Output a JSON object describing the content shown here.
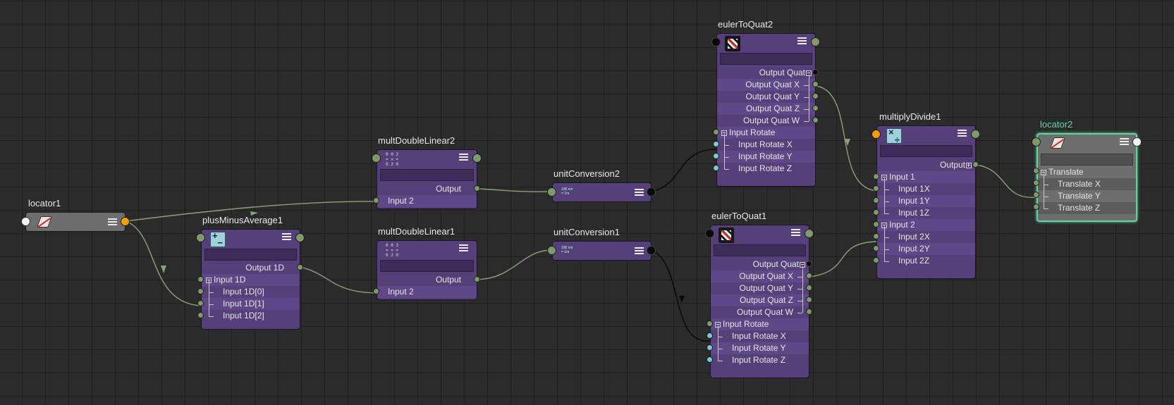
{
  "nodes": {
    "locator1": {
      "title": "locator1"
    },
    "plusMinusAverage1": {
      "title": "plusMinusAverage1",
      "output": "Output 1D",
      "input_group": "Input 1D",
      "inputs": [
        "Input 1D[0]",
        "Input 1D[1]",
        "Input 1D[2]"
      ]
    },
    "multDoubleLinear2": {
      "title": "multDoubleLinear2",
      "output": "Output",
      "input": "Input 2"
    },
    "multDoubleLinear1": {
      "title": "multDoubleLinear1",
      "output": "Output",
      "input": "Input 2"
    },
    "unitConversion2": {
      "title": "unitConversion2"
    },
    "unitConversion1": {
      "title": "unitConversion1"
    },
    "eulerToQuat2": {
      "title": "eulerToQuat2",
      "output_group": "Output Quat",
      "outputs": [
        "Output Quat X",
        "Output Quat Y",
        "Output Quat Z",
        "Output Quat W"
      ],
      "input_group": "Input Rotate",
      "inputs": [
        "Input Rotate X",
        "Input Rotate Y",
        "Input Rotate Z"
      ]
    },
    "eulerToQuat1": {
      "title": "eulerToQuat1",
      "output_group": "Output Quat",
      "outputs": [
        "Output Quat X",
        "Output Quat Y",
        "Output Quat Z",
        "Output Quat W"
      ],
      "input_group": "Input Rotate",
      "inputs": [
        "Input Rotate X",
        "Input Rotate Y",
        "Input Rotate Z"
      ]
    },
    "multiplyDivide1": {
      "title": "multiplyDivide1",
      "output": "Output",
      "input1_group": "Input 1",
      "inputs1": [
        "Input 1X",
        "Input 1Y",
        "Input 1Z"
      ],
      "input2_group": "Input 2",
      "inputs2": [
        "Input 2X",
        "Input 2Y",
        "Input 2Z"
      ]
    },
    "locator2": {
      "title": "locator2",
      "group": "Translate",
      "attrs": [
        "Translate X",
        "Translate Y",
        "Translate Z"
      ]
    }
  },
  "icons": {
    "mdl_icon_line1": "0 0 3",
    "mdl_icon_line2": "= ✕ =",
    "mdl_icon_line3": "0 2 0",
    "uc_icon_line1": "100 cm",
    "uc_icon_line2": "= 1m"
  },
  "colors": {
    "background": "#2b2b2b",
    "node_purple": "#55407a",
    "node_grey": "#6e6e6e",
    "selected_outline": "#5fd4a0",
    "wire": "#8aa27a",
    "wire_active": "#0a0a0a"
  }
}
